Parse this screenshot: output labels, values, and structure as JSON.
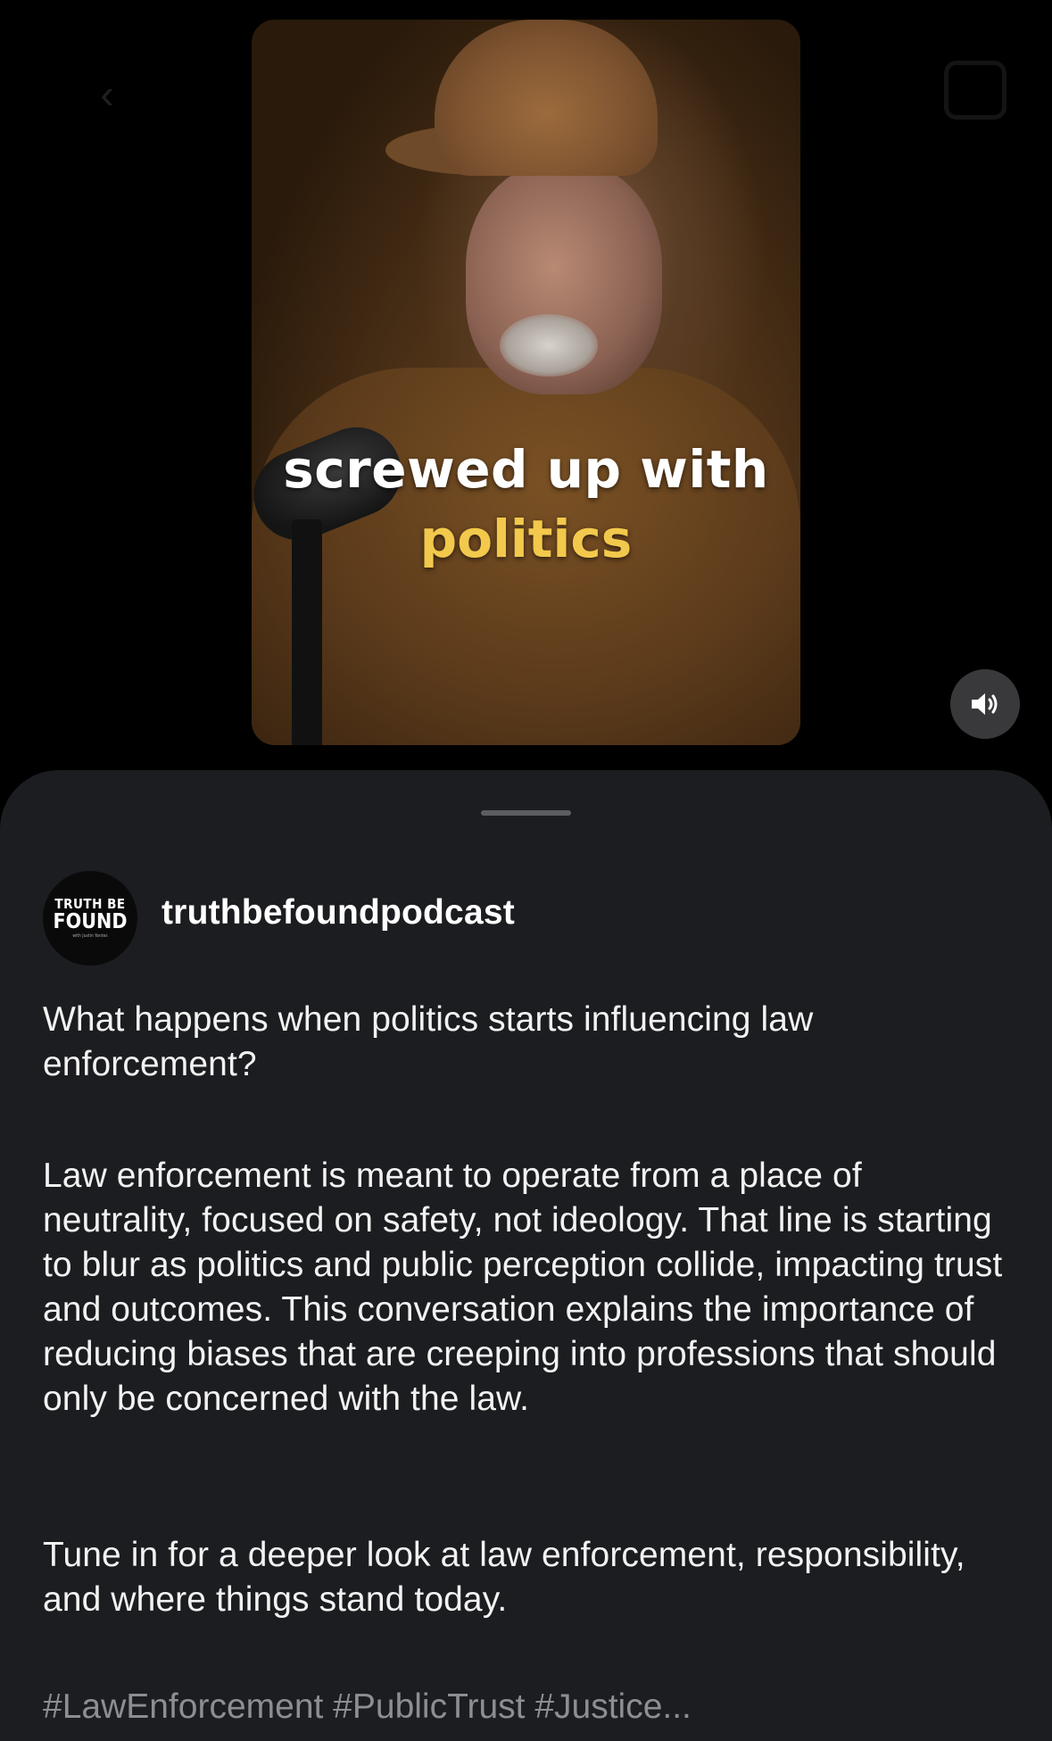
{
  "video": {
    "caption_line1": "screwed up with",
    "caption_line2": "politics",
    "caption_highlight_color": "#f2c94c",
    "buttons": {
      "back_icon": "chevron-left-icon",
      "camera_icon": "camera-icon",
      "mute_icon": "speaker-icon"
    }
  },
  "post": {
    "avatar": {
      "line1": "TRUTH BE",
      "line2": "FOUND",
      "line3": "with Justin Yantes"
    },
    "username": "truthbefoundpodcast",
    "paragraphs": [
      "What happens when politics starts influencing law enforcement?",
      "Law enforcement is meant to operate from a place of neutrality, focused on safety, not ideology. That line is starting to blur as politics and public perception collide, impacting trust and outcomes. This conversation explains the importance of reducing biases that are creeping into professions that should only be concerned with the law.",
      "Tune in for a deeper look at law enforcement, responsibility, and where things stand today."
    ],
    "hashtags": "#LawEnforcement #PublicTrust #Justice..."
  },
  "colors": {
    "sheet_background": "#1c1d20",
    "text_primary": "#f2f2f2",
    "text_muted": "#8c8e92"
  }
}
